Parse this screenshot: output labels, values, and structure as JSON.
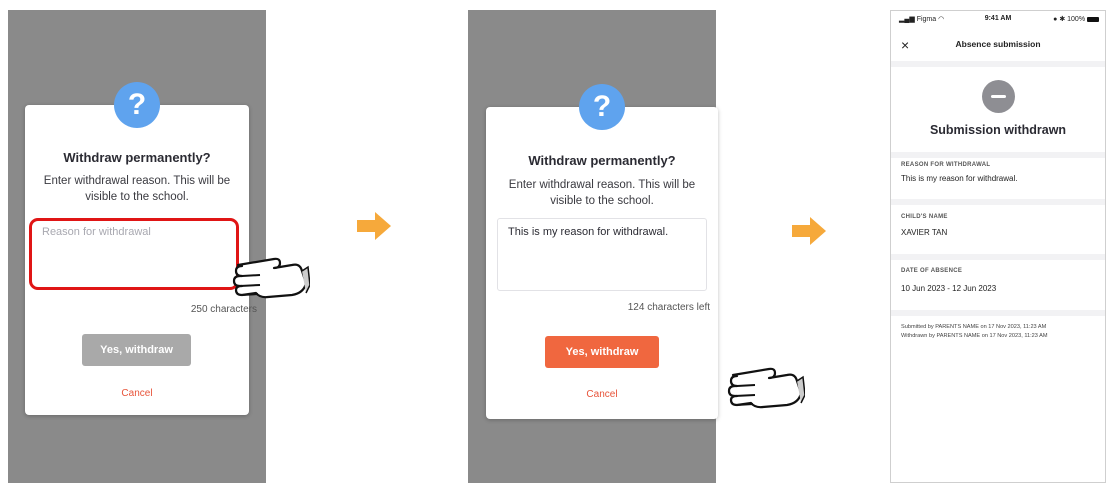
{
  "step1": {
    "title": "Withdraw permanently?",
    "description": "Enter withdrawal reason. This will be visible to the school.",
    "reason_placeholder": "Reason for withdrawal",
    "char_count": "250 characters",
    "withdraw_label": "Yes, withdraw",
    "cancel_label": "Cancel",
    "question_mark": "?"
  },
  "step2": {
    "title": "Withdraw permanently?",
    "description": "Enter withdrawal reason. This will be visible to the school.",
    "reason_value": "This is my reason for withdrawal.",
    "char_count": "124 characters left",
    "withdraw_label": "Yes, withdraw",
    "cancel_label": "Cancel",
    "question_mark": "?"
  },
  "step3": {
    "status_bar": {
      "carrier": "Figma",
      "time": "9:41 AM",
      "battery": "100%"
    },
    "nav_title": "Absence submission",
    "close_glyph": "×",
    "hero_title": "Submission withdrawn",
    "fields": [
      {
        "label": "REASON FOR WITHDRAWAL",
        "value": "This is my reason for withdrawal."
      },
      {
        "label": "CHILD'S NAME",
        "value": "XAVIER TAN"
      },
      {
        "label": "DATE OF ABSENCE",
        "value": "10 Jun 2023 - 12 Jun 2023"
      }
    ],
    "submitted_text": "Submitted by PARENTS NAME on 17 Nov 2023, 11:23 AM",
    "withdrawn_text": "Withdrawn by PARENTS NAME on 17 Nov 2023, 11:23 AM"
  },
  "colors": {
    "overlay": "#8a8a8a",
    "icon_blue": "#5fa3ee",
    "button_disabled": "#a9a9a9",
    "button_active": "#f0673f",
    "cancel": "#e8543a",
    "highlight_red": "#e01515",
    "arrow_orange": "#f6a93b",
    "withdrawn_icon": "#8e8e93"
  }
}
